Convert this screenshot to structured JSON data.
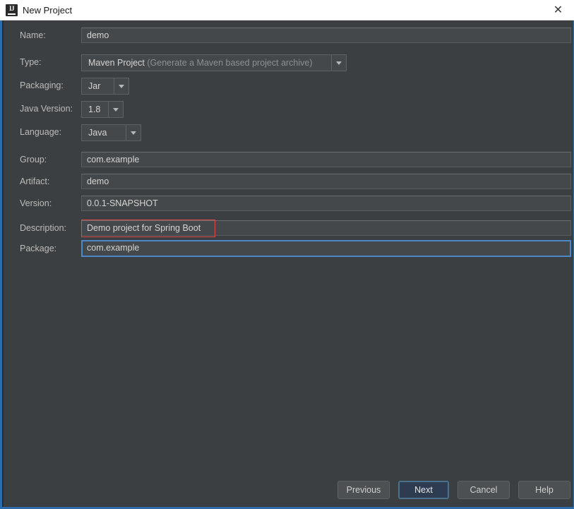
{
  "window": {
    "title": "New Project",
    "app_icon": "intellij-idea-icon",
    "close_icon": "✕"
  },
  "form": {
    "fields": [
      {
        "key": "name",
        "label": "Name:",
        "value": "demo",
        "kind": "text"
      },
      {
        "key": "type",
        "label": "Type:",
        "value": "Maven Project",
        "value_hint": " (Generate a Maven based project archive)",
        "kind": "combo"
      },
      {
        "key": "packaging",
        "label": "Packaging:",
        "value": "Jar",
        "kind": "combo"
      },
      {
        "key": "java_version",
        "label": "Java Version:",
        "value": "1.8",
        "kind": "combo"
      },
      {
        "key": "language",
        "label": "Language:",
        "value": "Java",
        "kind": "combo"
      },
      {
        "key": "group",
        "label": "Group:",
        "value": "com.example",
        "kind": "text"
      },
      {
        "key": "artifact",
        "label": "Artifact:",
        "value": "demo",
        "kind": "text"
      },
      {
        "key": "version",
        "label": "Version:",
        "value": "0.0.1-SNAPSHOT",
        "kind": "text"
      },
      {
        "key": "description",
        "label": "Description:",
        "value": "Demo project for Spring Boot",
        "kind": "text",
        "annotated": true
      },
      {
        "key": "package",
        "label": "Package:",
        "value": "com.example",
        "kind": "text",
        "focused": true
      }
    ]
  },
  "footer": {
    "buttons": [
      {
        "key": "previous",
        "label": "Previous",
        "primary": false
      },
      {
        "key": "next",
        "label": "Next",
        "primary": true
      },
      {
        "key": "cancel",
        "label": "Cancel",
        "primary": false
      },
      {
        "key": "help",
        "label": "Help",
        "primary": false
      }
    ]
  },
  "colors": {
    "background": "#3c3f41",
    "field_background": "#45484a",
    "titlebar_background": "#ffffff",
    "accent_border": "#2d6ca8",
    "annotation_red": "#e04a4a",
    "focus_blue": "#4a88c7",
    "primary_button": "#2d3c50",
    "text": "#d4d4d4",
    "label_text": "#bbbbbb",
    "dim_text": "#8d9093"
  }
}
